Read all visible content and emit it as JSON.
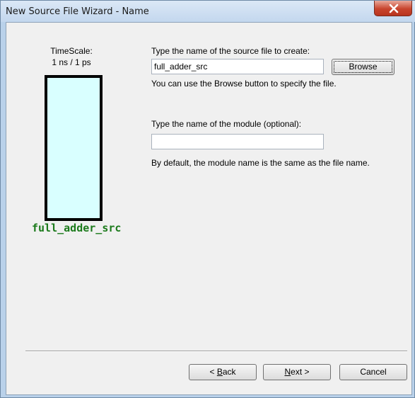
{
  "window": {
    "title": "New Source File Wizard - Name"
  },
  "preview": {
    "timescale_label": "TimeScale:",
    "timescale_value": "1 ns / 1 ps",
    "module_name": "full_adder_src"
  },
  "file": {
    "prompt": "Type the name of the source file to create:",
    "value": "full_adder_src",
    "browse_label": "Browse",
    "hint": "You can use the Browse button to specify the file."
  },
  "module": {
    "prompt": "Type the name of the module (optional):",
    "value": "",
    "hint": "By default, the module name is the same as the file name."
  },
  "buttons": {
    "back_prefix": "< ",
    "back_accel": "B",
    "back_rest": "ack",
    "next_accel": "N",
    "next_rest": "ext >",
    "cancel": "Cancel"
  },
  "colors": {
    "preview_fill": "#d9ffff",
    "module_name_color": "#1b7a1b",
    "close_button": "#c8442d"
  },
  "icons": {
    "close": "close-x-icon"
  }
}
